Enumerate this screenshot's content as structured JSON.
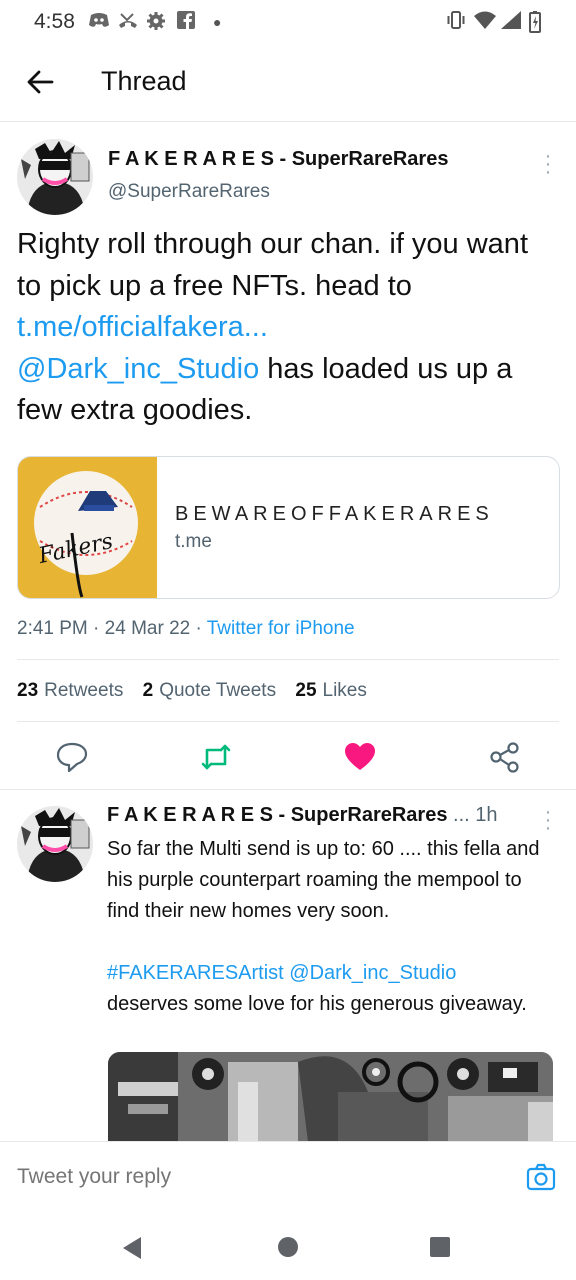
{
  "status_bar": {
    "time": "4:58",
    "left_icons": [
      "discord-icon",
      "missed-call-icon",
      "settings-icon",
      "facebook-icon",
      "dot-icon"
    ],
    "right_icons": [
      "vibrate-icon",
      "wifi-icon",
      "signal-icon",
      "battery-icon"
    ]
  },
  "header": {
    "title": "Thread"
  },
  "tweet": {
    "author": {
      "name": "F A K E R A R E S - SuperRareRares",
      "handle": "@SuperRareRares"
    },
    "body": {
      "line1": "Righty roll through our chan. if you want to pick up a free NFTs. head to ",
      "link1": "t.me/officialfakera...",
      "mention": "@Dark_inc_Studio",
      "line2": " has loaded us up a few extra goodies."
    },
    "card": {
      "title": "BEWAREOFFAKERARES",
      "domain": "t.me",
      "image_text": "Fakers"
    },
    "meta": {
      "time": "2:41 PM",
      "date": "24 Mar 22",
      "sep": " · ",
      "source": "Twitter for iPhone"
    },
    "stats": {
      "retweets_count": "23",
      "retweets_label": "Retweets",
      "quotes_count": "2",
      "quotes_label": "Quote Tweets",
      "likes_count": "25",
      "likes_label": "Likes"
    },
    "liked": true,
    "colors": {
      "link": "#1d9bf0",
      "retweet": "#00ba7c",
      "like": "#f91880"
    }
  },
  "reply": {
    "author": "F A K E R A R E S - SuperRareRares",
    "handle_truncated": "...",
    "time": "1h",
    "text1": "So far the Multi send is up to: 60 .... this fella and his purple counterpart roaming the mempool to find their new homes very soon.",
    "hashtag": "#FAKERARESArtist",
    "mention": "@Dark_inc_Studio",
    "text2": "deserves some love for his generous giveaway."
  },
  "composer": {
    "placeholder": "Tweet your reply"
  }
}
